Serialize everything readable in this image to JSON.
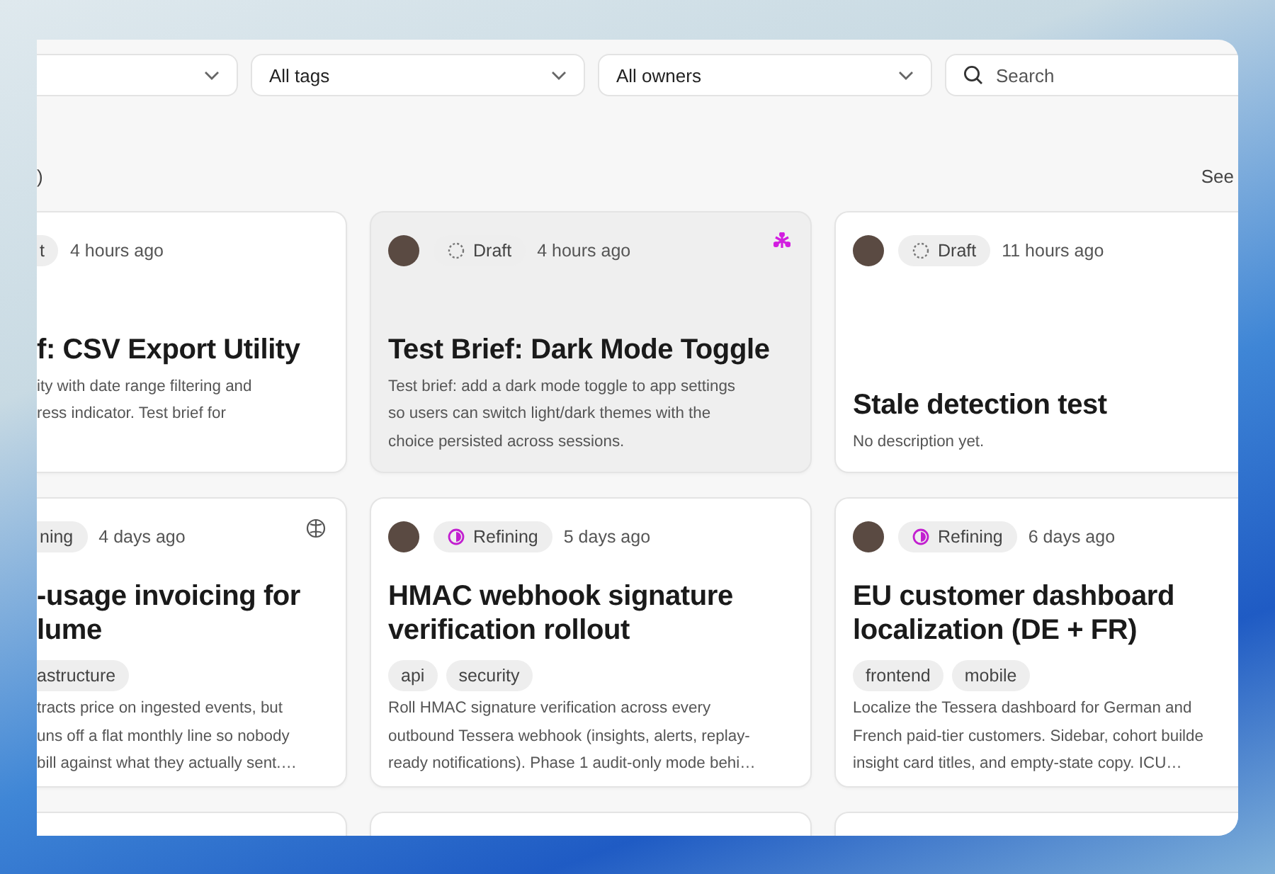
{
  "filters": [
    {
      "kind": "dropdown"
    },
    {
      "kind": "dropdown",
      "label": "All tags"
    },
    {
      "kind": "dropdown",
      "label": "All owners"
    },
    {
      "kind": "search",
      "placeholder": "Search"
    }
  ],
  "section": {
    "label": ")",
    "link": "See"
  },
  "cards": [
    {
      "cut_left": true,
      "cut_right": false,
      "hovered": false,
      "status": {
        "text": "t"
      },
      "time": "4 hours ago",
      "title": [
        "f: CSV Export Utility"
      ],
      "description": [
        "ity with date range filtering and",
        "ress indicator. Test brief for"
      ]
    },
    {
      "cut_left": false,
      "cut_right": false,
      "hovered": true,
      "avatar": true,
      "status": {
        "kind": "draft",
        "text": "Draft"
      },
      "time": "4 hours ago",
      "corner_icon": {
        "kind": "sparkle"
      },
      "title": [
        "Test Brief: Dark Mode Toggle"
      ],
      "description": [
        "Test brief: add a dark mode toggle to app settings",
        "so users can switch light/dark themes with the",
        "choice persisted across sessions."
      ]
    },
    {
      "cut_left": false,
      "cut_right": true,
      "hovered": false,
      "avatar": true,
      "status": {
        "kind": "draft",
        "text": "Draft"
      },
      "time": "11 hours ago",
      "title": [
        "Stale detection test"
      ],
      "description": [
        "No description yet."
      ]
    },
    {
      "cut_left": true,
      "cut_right": false,
      "hovered": false,
      "status": {
        "text": "ning"
      },
      "time": "4 days ago",
      "corner_icon": {
        "kind": "globe"
      },
      "title": [
        "-usage invoicing for",
        "lume"
      ],
      "tags": [
        "astructure"
      ],
      "description": [
        "tracts price on ingested events, but",
        "uns off a flat monthly line so nobody",
        "bill against what they actually sent.…"
      ]
    },
    {
      "cut_left": false,
      "cut_right": false,
      "hovered": false,
      "avatar": true,
      "status": {
        "kind": "refining",
        "text": "Refining"
      },
      "time": "5 days ago",
      "title": [
        "HMAC webhook signature",
        "verification rollout"
      ],
      "tags": [
        "api",
        "security"
      ],
      "description": [
        "Roll HMAC signature verification across every",
        "outbound Tessera webhook (insights, alerts, replay-",
        "ready notifications). Phase 1 audit-only mode behi…"
      ]
    },
    {
      "cut_left": false,
      "cut_right": true,
      "hovered": false,
      "avatar": true,
      "status": {
        "kind": "refining",
        "text": "Refining"
      },
      "time": "6 days ago",
      "title": [
        "EU customer dashboard",
        "localization (DE + FR)"
      ],
      "tags": [
        "frontend",
        "mobile"
      ],
      "description": [
        "Localize the Tessera dashboard for German and",
        "French paid-tier customers. Sidebar, cohort builde",
        "insight card titles, and empty-state copy. ICU…"
      ]
    }
  ]
}
